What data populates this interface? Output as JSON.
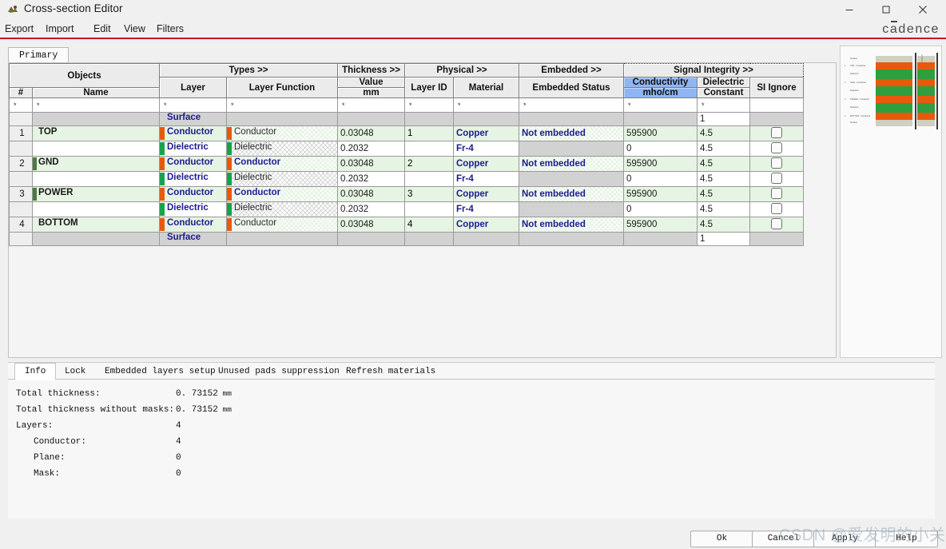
{
  "window": {
    "title": "Cross-section Editor",
    "icon": "app-icon",
    "controls": {
      "minimize": "–",
      "maximize": "□",
      "close": "✕"
    }
  },
  "menubar": {
    "items": [
      "Export",
      "Import",
      "Edit",
      "View",
      "Filters"
    ]
  },
  "brand": {
    "name": "cadence",
    "accent": "#c8102e"
  },
  "tabs": {
    "items": [
      "Primary"
    ],
    "active": "Primary"
  },
  "grid": {
    "group_headers": [
      {
        "label": "Objects",
        "span": 2
      },
      {
        "label": "Types >>",
        "span": 2
      },
      {
        "label": "Thickness >>",
        "span": 1
      },
      {
        "label": "Physical >>",
        "span": 2
      },
      {
        "label": "Embedded >>",
        "span": 1
      },
      {
        "label": "Signal Integrity >>",
        "span": 3,
        "focused": true
      }
    ],
    "columns": [
      {
        "key": "num",
        "label": "#",
        "sub": ""
      },
      {
        "key": "name",
        "label": "Name",
        "sub": ""
      },
      {
        "key": "layer",
        "label": "Layer",
        "sub": ""
      },
      {
        "key": "layerfn",
        "label": "Layer Function",
        "sub": ""
      },
      {
        "key": "thickness",
        "label": "Value",
        "sub": "mm"
      },
      {
        "key": "layerid",
        "label": "Layer ID",
        "sub": ""
      },
      {
        "key": "material",
        "label": "Material",
        "sub": ""
      },
      {
        "key": "embedded",
        "label": "Embedded Status",
        "sub": ""
      },
      {
        "key": "conduct",
        "label": "Conductivity",
        "sub": "mho/cm",
        "selected": true
      },
      {
        "key": "dielectric",
        "label": "Dielectric",
        "sub": "Constant"
      },
      {
        "key": "siignore",
        "label": "SI Ignore",
        "sub": ""
      }
    ],
    "filter_row": {
      "marker": "*"
    },
    "rows": [
      {
        "num": "",
        "name": "",
        "layer": "Surface",
        "layer_swatch": "none",
        "layerfn": "",
        "fn_swatch": "none",
        "thickness": "",
        "layerid": "",
        "material": "",
        "embedded": "",
        "conduct": "",
        "dielectric": "1",
        "si_ignore": null,
        "shade": "gray",
        "plane": false
      },
      {
        "num": "1",
        "name": "TOP",
        "layer": "Conductor",
        "layer_swatch": "conductor",
        "layerfn": "Conductor",
        "fn_swatch": "conductor",
        "thickness": "0.03048",
        "layerid": "1",
        "material": "Copper",
        "embedded": "Not embedded",
        "conduct": "595900",
        "dielectric": "4.5",
        "si_ignore": false,
        "shade": "green",
        "plane": false
      },
      {
        "num": "",
        "name": "",
        "layer": "Dielectric",
        "layer_swatch": "dielectric",
        "layerfn": "Dielectric",
        "fn_swatch": "dielectric",
        "thickness": "0.2032",
        "layerid": "",
        "material": "Fr-4",
        "embedded": "",
        "conduct": "0",
        "dielectric": "4.5",
        "si_ignore": false,
        "shade": "white",
        "plane": false
      },
      {
        "num": "2",
        "name": "GND",
        "layer": "Conductor",
        "layer_swatch": "conductor",
        "layerfn": "Conductor",
        "fn_swatch": "conductor",
        "thickness": "0.03048",
        "layerid": "2",
        "material": "Copper",
        "embedded": "Not embedded",
        "conduct": "595900",
        "dielectric": "4.5",
        "si_ignore": false,
        "shade": "green",
        "plane": true
      },
      {
        "num": "",
        "name": "",
        "layer": "Dielectric",
        "layer_swatch": "dielectric",
        "layerfn": "Dielectric",
        "fn_swatch": "dielectric",
        "thickness": "0.2032",
        "layerid": "",
        "material": "Fr-4",
        "embedded": "",
        "conduct": "0",
        "dielectric": "4.5",
        "si_ignore": false,
        "shade": "white",
        "plane": false
      },
      {
        "num": "3",
        "name": "POWER",
        "layer": "Conductor",
        "layer_swatch": "conductor",
        "layerfn": "Conductor",
        "fn_swatch": "conductor",
        "thickness": "0.03048",
        "layerid": "3",
        "material": "Copper",
        "embedded": "Not embedded",
        "conduct": "595900",
        "dielectric": "4.5",
        "si_ignore": false,
        "shade": "green",
        "plane": true
      },
      {
        "num": "",
        "name": "",
        "layer": "Dielectric",
        "layer_swatch": "dielectric",
        "layerfn": "Dielectric",
        "fn_swatch": "dielectric",
        "thickness": "0.2032",
        "layerid": "",
        "material": "Fr-4",
        "embedded": "",
        "conduct": "0",
        "dielectric": "4.5",
        "si_ignore": false,
        "shade": "white",
        "plane": false
      },
      {
        "num": "4",
        "name": "BOTTOM",
        "layer": "Conductor",
        "layer_swatch": "conductor",
        "layerfn": "Conductor",
        "fn_swatch": "conductor",
        "thickness": "0.03048",
        "layerid": "4",
        "material": "Copper",
        "embedded": "Not embedded",
        "conduct": "595900",
        "dielectric": "4.5",
        "si_ignore": false,
        "shade": "green",
        "plane": false
      },
      {
        "num": "",
        "name": "",
        "layer": "Surface",
        "layer_swatch": "none",
        "layerfn": "",
        "fn_swatch": "none",
        "thickness": "",
        "layerid": "",
        "material": "",
        "embedded": "",
        "conduct": "",
        "dielectric": "1",
        "si_ignore": null,
        "shade": "gray",
        "plane": false
      }
    ]
  },
  "preview": {
    "labels": [
      "Surface",
      "TOP - Conductor",
      "Dielectric",
      "GND - Conductor",
      "Dielectric",
      "POWER - Conductor",
      "Dielectric",
      "BOTTOM - Conductor",
      "Surface"
    ],
    "numbers": [
      "",
      "1",
      "",
      "2",
      "",
      "3",
      "",
      "4",
      ""
    ],
    "band_colors": [
      "#cfcfc2",
      "#e8590c",
      "#2e9e3e",
      "#e8590c",
      "#2e9e3e",
      "#e8590c",
      "#2e9e3e",
      "#e8590c",
      "#cfcfc2"
    ],
    "side_label": "0.73152"
  },
  "bottom_tabs": {
    "items": [
      "Info",
      "Lock",
      "Embedded layers setup",
      "Unused pads suppression",
      "Refresh materials"
    ],
    "active": "Info"
  },
  "info": {
    "rows": [
      {
        "label": "Total thickness:",
        "value": "0. 73152",
        "unit": "mm"
      },
      {
        "label": "Total thickness without masks:",
        "value": "0. 73152",
        "unit": "mm"
      },
      {
        "label": "Layers:",
        "value": "4",
        "unit": ""
      },
      {
        "label": "Conductor:",
        "value": "4",
        "unit": "",
        "indent": true
      },
      {
        "label": "Plane:",
        "value": "0",
        "unit": "",
        "indent": true
      },
      {
        "label": "Mask:",
        "value": "0",
        "unit": "",
        "indent": true
      }
    ]
  },
  "footer": {
    "buttons": [
      "Ok",
      "Cancel",
      "Apply",
      "Help"
    ]
  },
  "watermark": {
    "text": "CSDN @爱发明的小关"
  }
}
